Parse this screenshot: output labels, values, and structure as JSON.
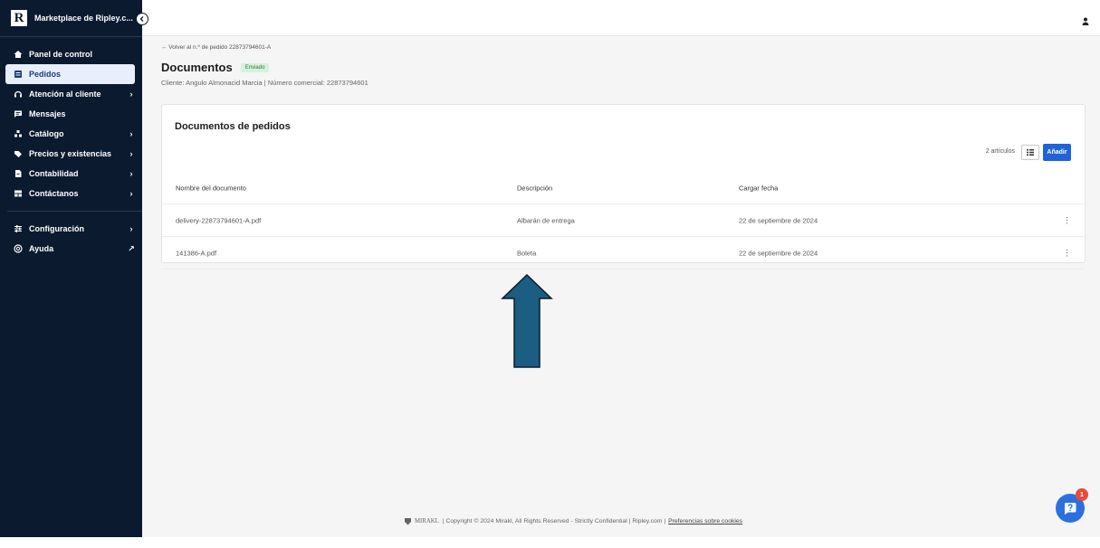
{
  "app": {
    "brand_letter": "R",
    "brand_name": "Marketplace de Ripley.c..."
  },
  "sidebar": {
    "items": [
      {
        "label": "Panel de control",
        "icon": "home-icon",
        "chevron": ""
      },
      {
        "label": "Pedidos",
        "icon": "orders-icon",
        "chevron": ""
      },
      {
        "label": "Atención al cliente",
        "icon": "headset-icon",
        "chevron": "›"
      },
      {
        "label": "Mensajes",
        "icon": "message-icon",
        "chevron": ""
      },
      {
        "label": "Catálogo",
        "icon": "catalog-icon",
        "chevron": "›"
      },
      {
        "label": "Precios y existencias",
        "icon": "tag-icon",
        "chevron": "›"
      },
      {
        "label": "Contabilidad",
        "icon": "accounting-icon",
        "chevron": "›"
      },
      {
        "label": "Contáctanos",
        "icon": "contact-icon",
        "chevron": "›"
      }
    ],
    "bottom_items": [
      {
        "label": "Configuración",
        "icon": "settings-icon",
        "chevron": "›"
      },
      {
        "label": "Ayuda",
        "icon": "help-icon",
        "chevron": "↗"
      }
    ],
    "active_index": 1
  },
  "page": {
    "back_link": "← Volver al n.º de pedido 22873794601-A",
    "title": "Documentos",
    "status_badge": "Enviado",
    "subtitle": "Cliente: Angulo Almonacid Marcia | Número comercial: 22873794601"
  },
  "card": {
    "title": "Documentos de pedidos",
    "count_label": "2 artículos",
    "add_button": "Añadir",
    "columns": [
      "Nombre del documento",
      "Descripción",
      "Cargar fecha"
    ],
    "rows": [
      {
        "name": "delivery-22873794601-A.pdf",
        "description": "Albarán de entrega",
        "date": "22 de septiembre de 2024"
      },
      {
        "name": "141386-A.pdf",
        "description": "Boleta",
        "date": "22 de septiembre de 2024"
      }
    ]
  },
  "footer": {
    "brand": "MIRAKL",
    "copyright": "| Copyright © 2024 Mirakl, All Rights Reserved - Strictly Confidential | Ripley.com  |",
    "cookies_link": "Preferencias sobre cookies"
  },
  "help_widget": {
    "badge_count": "1"
  },
  "colors": {
    "sidebar_bg": "#0b1a2e",
    "primary": "#1f63d8",
    "badge_bg": "#d6f1dc",
    "arrow_fill": "#1c5d82"
  }
}
